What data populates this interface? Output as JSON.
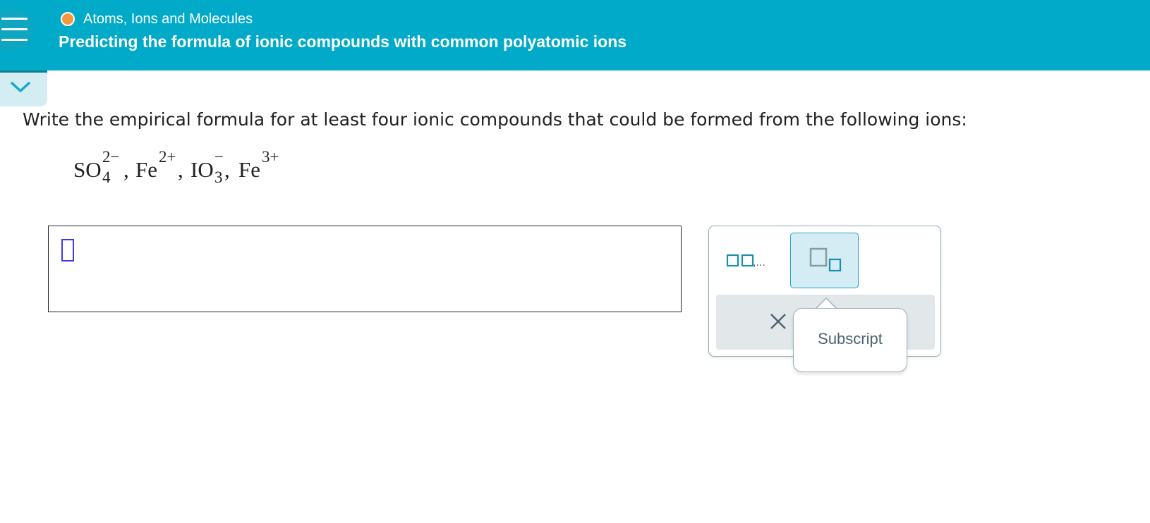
{
  "header": {
    "topic": "Atoms, Ions and Molecules",
    "title": "Predicting the formula of ionic compounds with common polyatomic ions",
    "topic_dot_color": "#f59a3c",
    "bar_color": "#01aac9",
    "menu_icon": "hamburger-icon"
  },
  "nav": {
    "collapse_icon": "chevron-down-icon"
  },
  "question": {
    "prompt": "Write the empirical formula for at least four ionic compounds that could be formed from the following ions:",
    "ions": [
      {
        "symbol": "SO",
        "subscript": "4",
        "charge": "2−"
      },
      {
        "symbol": "Fe",
        "subscript": "",
        "charge": "2+"
      },
      {
        "symbol": "IO",
        "subscript": "3",
        "charge": "−"
      },
      {
        "symbol": "Fe",
        "subscript": "",
        "charge": "3+"
      }
    ],
    "separator": ","
  },
  "answer": {
    "value": ""
  },
  "palette": {
    "list_button_icon": "comma-list-icon",
    "list_button_text": ",...",
    "subscript_button_icon": "subscript-icon",
    "clear_icon": "close-icon",
    "tooltip": "Subscript"
  }
}
